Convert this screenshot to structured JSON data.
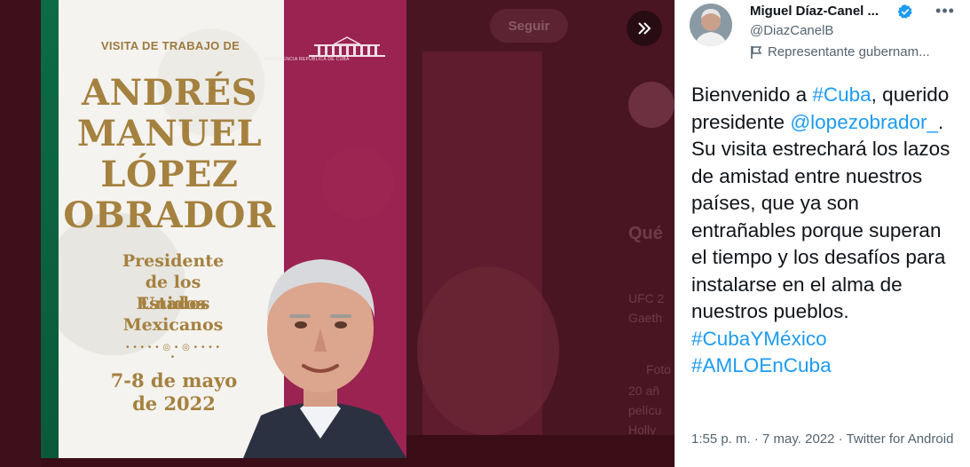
{
  "background": {
    "follow_label": "Seguir",
    "texts": [
      {
        "text": "Qué"
      },
      {
        "text": "UFC 2"
      },
      {
        "text": "Gaeth"
      },
      {
        "text": "Foto"
      },
      {
        "text": "20 añ"
      },
      {
        "text": "pelícu"
      },
      {
        "text": "Holly"
      }
    ]
  },
  "poster": {
    "visit_title": "VISITA DE TRABAJO DE",
    "name_lines": [
      "ANDRÉS",
      "MANUEL",
      "LÓPEZ",
      "OBRADOR"
    ],
    "role_lines": [
      "Presidente",
      "de los Estados",
      "Unidos",
      "Mexicanos"
    ],
    "date_lines": [
      "7-8 de mayo",
      "de 2022"
    ],
    "gov_logo_text": "PRESIDENCIA REPÚBLICA DE CUBA",
    "colors": {
      "gold": "#a5813f",
      "magenta": "#9a2352",
      "green": "#0d6b45"
    }
  },
  "tweet": {
    "author_name": "Miguel Díaz-Canel ...",
    "handle": "@DiazCanelB",
    "label": "Representante gubernam...",
    "text_parts": [
      {
        "t": "Bienvenido a ",
        "link": false
      },
      {
        "t": "#Cuba",
        "link": true
      },
      {
        "t": ", querido presidente ",
        "link": false
      },
      {
        "t": "@lopezobrador_",
        "link": true
      },
      {
        "t": ". Su visita estrechará los lazos de amistad entre nuestros países, que ya son entrañables porque superan el tiempo y los desafíos para instalarse en el alma de nuestros pueblos. ",
        "link": false
      },
      {
        "t": "#CubaYMéxico",
        "link": true
      },
      {
        "t": " ",
        "link": false
      },
      {
        "t": "#AMLOEnCuba",
        "link": true
      }
    ],
    "meta": "1:55 p. m. · 7 may. 2022 · Twitter for Android",
    "colors": {
      "link": "#1d9bf0",
      "text": "#0f1419",
      "muted": "#536471",
      "verified": "#1d9bf0"
    }
  }
}
